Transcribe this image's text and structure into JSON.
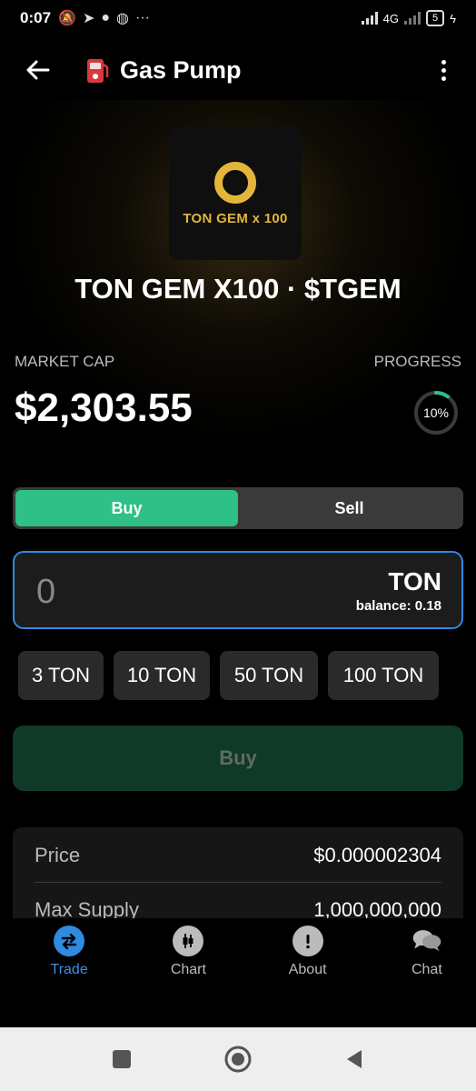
{
  "status": {
    "time": "0:07",
    "network": "4G",
    "battery": "5"
  },
  "header": {
    "title": "Gas Pump"
  },
  "token": {
    "logo_text": "TON GEM x 100",
    "name": "TON GEM X100 · $TGEM"
  },
  "stats": {
    "market_cap_label": "MARKET CAP",
    "market_cap_value": "$2,303.55",
    "progress_label": "PROGRESS",
    "progress_value": "10%",
    "progress_fraction": 0.1
  },
  "trade": {
    "buy_tab": "Buy",
    "sell_tab": "Sell",
    "amount_value": "0",
    "currency": "TON",
    "balance": "balance: 0.18",
    "presets": [
      "3 TON",
      "10 TON",
      "50 TON",
      "100 TON"
    ],
    "submit_label": "Buy"
  },
  "info": {
    "rows": [
      {
        "label": "Price",
        "value": "$0.000002304"
      },
      {
        "label": "Max Supply",
        "value": "1,000,000,000"
      }
    ]
  },
  "nav": {
    "items": [
      "Trade",
      "Chart",
      "About",
      "Chat"
    ],
    "active": "Trade"
  },
  "colors": {
    "accent_green": "#2ec087",
    "accent_blue": "#2f8ae0",
    "gold": "#e3b53a"
  }
}
